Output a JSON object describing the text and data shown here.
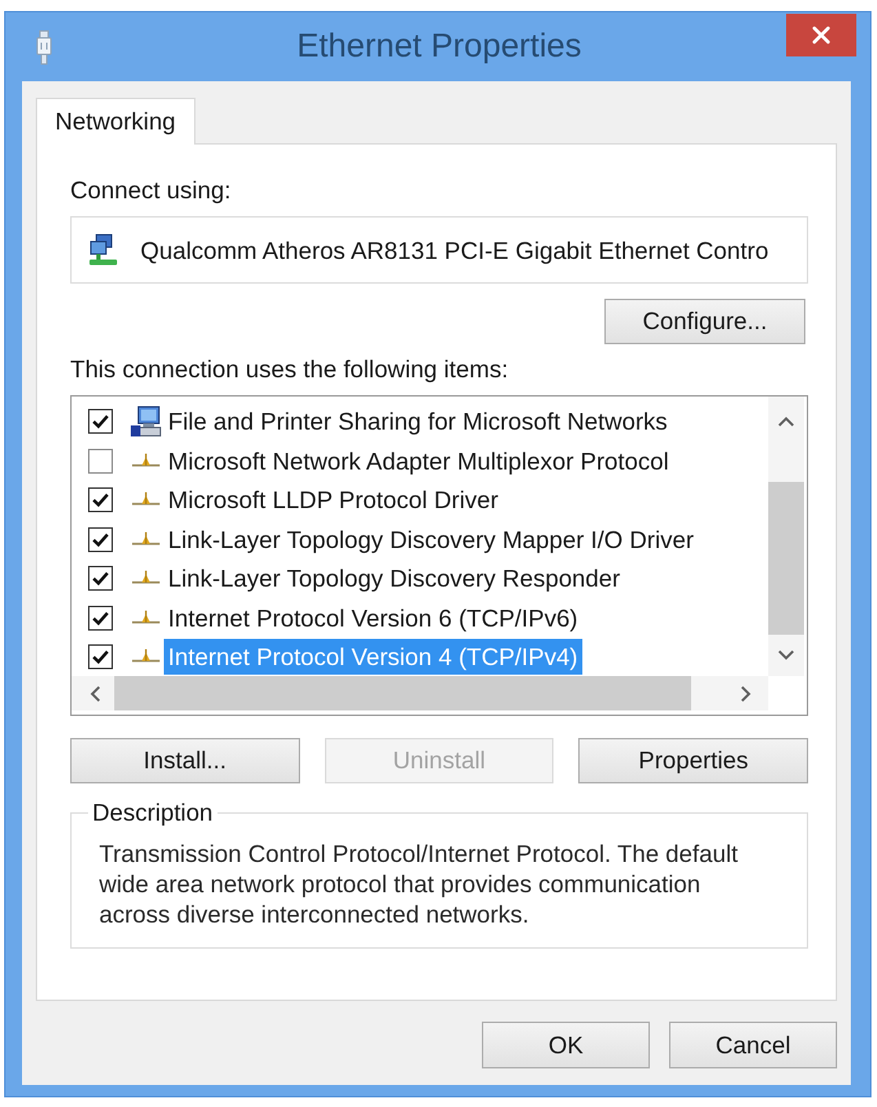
{
  "window": {
    "title": "Ethernet Properties"
  },
  "tabs": [
    {
      "label": "Networking",
      "selected": true
    }
  ],
  "connect_using": {
    "label": "Connect using:",
    "adapter": "Qualcomm Atheros AR8131 PCI-E Gigabit Ethernet Contro",
    "configure_button": "Configure..."
  },
  "components": {
    "label": "This connection uses the following items:",
    "items": [
      {
        "kind": "service",
        "label": "File and Printer Sharing for Microsoft Networks",
        "checked": true,
        "selected": false
      },
      {
        "kind": "protocol",
        "label": "Microsoft Network Adapter Multiplexor Protocol",
        "checked": false,
        "selected": false
      },
      {
        "kind": "protocol",
        "label": "Microsoft LLDP Protocol Driver",
        "checked": true,
        "selected": false
      },
      {
        "kind": "protocol",
        "label": "Link-Layer Topology Discovery Mapper I/O Driver",
        "checked": true,
        "selected": false
      },
      {
        "kind": "protocol",
        "label": "Link-Layer Topology Discovery Responder",
        "checked": true,
        "selected": false
      },
      {
        "kind": "protocol",
        "label": "Internet Protocol Version 6 (TCP/IPv6)",
        "checked": true,
        "selected": false
      },
      {
        "kind": "protocol",
        "label": "Internet Protocol Version 4 (TCP/IPv4)",
        "checked": true,
        "selected": true
      }
    ]
  },
  "component_buttons": [
    {
      "label": "Install...",
      "disabled": false
    },
    {
      "label": "Uninstall",
      "disabled": true
    },
    {
      "label": "Properties",
      "disabled": false
    }
  ],
  "description": {
    "legend": "Description",
    "text": "Transmission Control Protocol/Internet Protocol. The default wide area network protocol that provides communication across diverse interconnected networks."
  },
  "buttons": [
    {
      "label": "OK"
    },
    {
      "label": "Cancel"
    }
  ]
}
